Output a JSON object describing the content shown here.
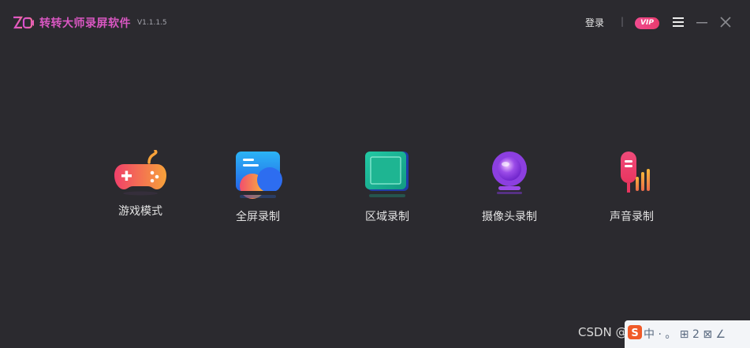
{
  "app": {
    "title": "转转大师录屏软件",
    "version": "V1.1.1.5",
    "logo_text": "ZO"
  },
  "header": {
    "login_label": "登录",
    "separator": "|",
    "vip_label": "VIP",
    "icons": [
      "menu-icon",
      "minimize-icon",
      "close-icon"
    ]
  },
  "modes": [
    {
      "label": "游戏模式",
      "icon": "gamepad-icon"
    },
    {
      "label": "全屏录制",
      "icon": "fullscreen-icon"
    },
    {
      "label": "区域录制",
      "icon": "region-icon"
    },
    {
      "label": "摄像头录制",
      "icon": "camera-icon"
    },
    {
      "label": "声音录制",
      "icon": "microphone-icon"
    }
  ],
  "overlay": {
    "watermark": "CSDN @",
    "ime_text": "中 · 。 ⊞ 2 ⊠ ∠"
  },
  "colors": {
    "background": "#2b2a2f",
    "title_accent": "#d957c2",
    "vip": "#f04b8f"
  }
}
